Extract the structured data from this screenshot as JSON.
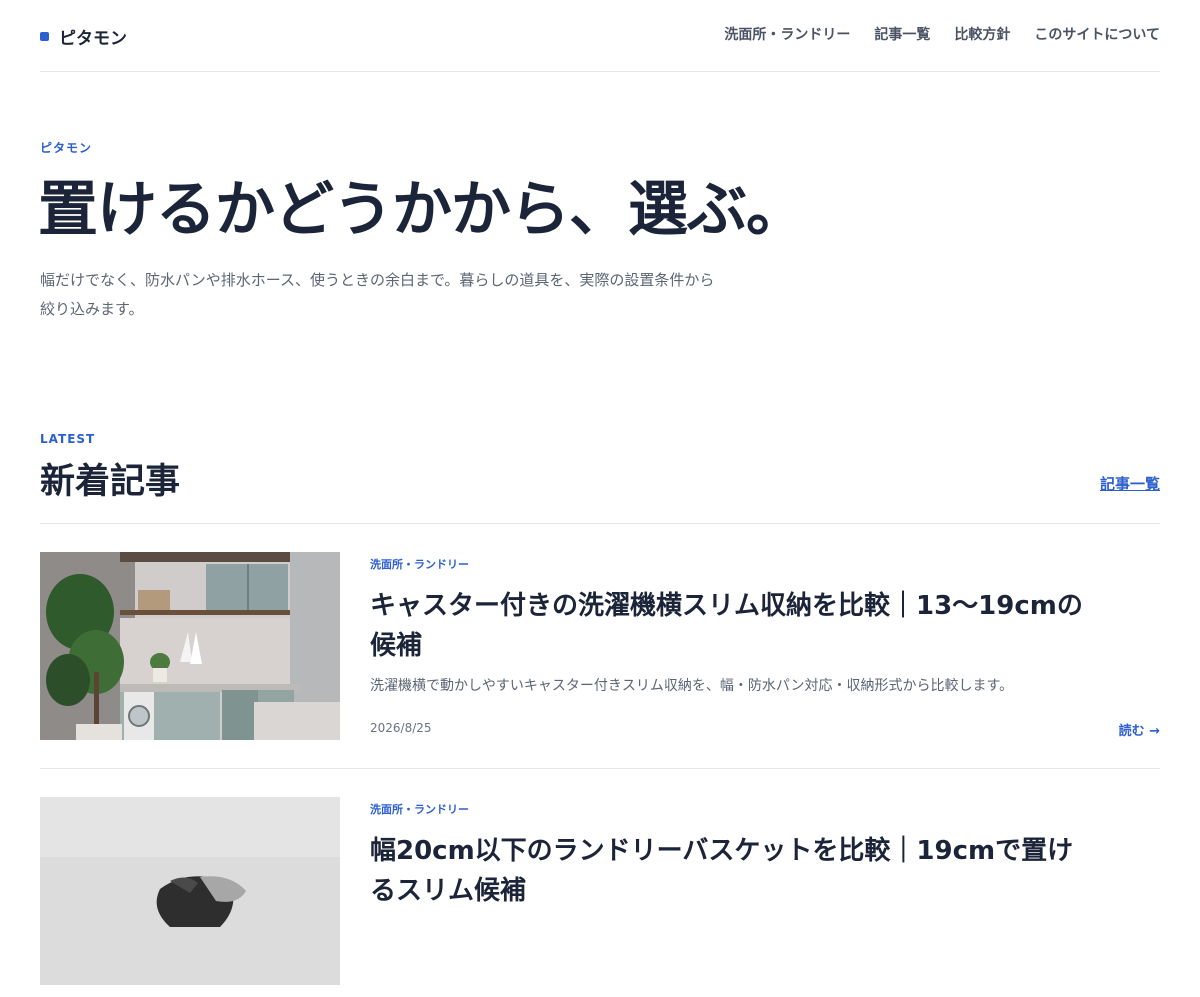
{
  "site": {
    "name": "ピタモン"
  },
  "nav": {
    "items": [
      "洗面所・ランドリー",
      "記事一覧",
      "比較方針",
      "このサイトについて"
    ]
  },
  "hero": {
    "eyebrow": "ピタモン",
    "title": "置けるかどうかから、選ぶ。",
    "lead": "幅だけでなく、防水パンや排水ホース、使うときの余白まで。暮らしの道具を、実際の設置条件から絞り込みます。"
  },
  "latest": {
    "label": "LATEST",
    "title": "新着記事",
    "all_link": "記事一覧"
  },
  "articles": [
    {
      "category": "洗面所・ランドリー",
      "title": "キャスター付きの洗濯機横スリム収納を比較｜13〜19cmの候補",
      "excerpt": "洗濯機横で動かしやすいキャスター付きスリム収納を、幅・防水パン対応・収納形式から比較します。",
      "date": "2026/8/25",
      "read": "読む →"
    },
    {
      "category": "洗面所・ランドリー",
      "title": "幅20cm以下のランドリーバスケットを比較｜19cmで置けるスリム候補",
      "excerpt": "",
      "date": "",
      "read": ""
    }
  ],
  "colors": {
    "accent": "#2c5fcf",
    "text": "#1b2438",
    "muted": "#5c6574",
    "rule": "#e3e6ea"
  }
}
